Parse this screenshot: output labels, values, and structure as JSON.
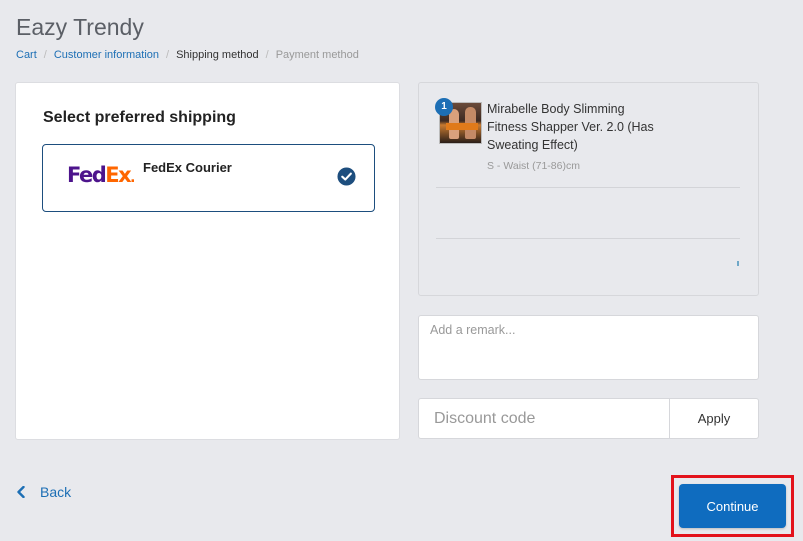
{
  "store": {
    "title": "Eazy Trendy"
  },
  "breadcrumb": [
    {
      "label": "Cart",
      "state": "link"
    },
    {
      "label": "Customer information",
      "state": "link"
    },
    {
      "label": "Shipping method",
      "state": "current"
    },
    {
      "label": "Payment method",
      "state": "future"
    }
  ],
  "breadcrumb_separator": "/",
  "shipping": {
    "heading": "Select preferred shipping",
    "options": [
      {
        "logo_text_fed": "Fed",
        "logo_text_ex": "Ex",
        "logo_text_dot": ".",
        "name": "FedEx Courier",
        "selected": true,
        "icon": "check-circle-icon"
      }
    ]
  },
  "order_summary": {
    "items": [
      {
        "quantity": "1",
        "name": "Mirabelle Body Slimming Fitness Shapper Ver. 2.0 (Has Sweating Effect)",
        "variant": "S - Waist (71-86)cm",
        "icon": "product-thumbnail"
      }
    ]
  },
  "remark": {
    "placeholder": "Add a remark...",
    "value": ""
  },
  "discount": {
    "placeholder": "Discount code",
    "value": "",
    "apply_label": "Apply"
  },
  "nav": {
    "back_label": "Back",
    "back_icon": "chevron-left-icon",
    "continue_label": "Continue"
  },
  "colors": {
    "accent": "#0f6cbf",
    "link": "#1d6fb5",
    "highlight": "#e3121b",
    "fedex_purple": "#4d148c",
    "fedex_orange": "#ff6600"
  }
}
